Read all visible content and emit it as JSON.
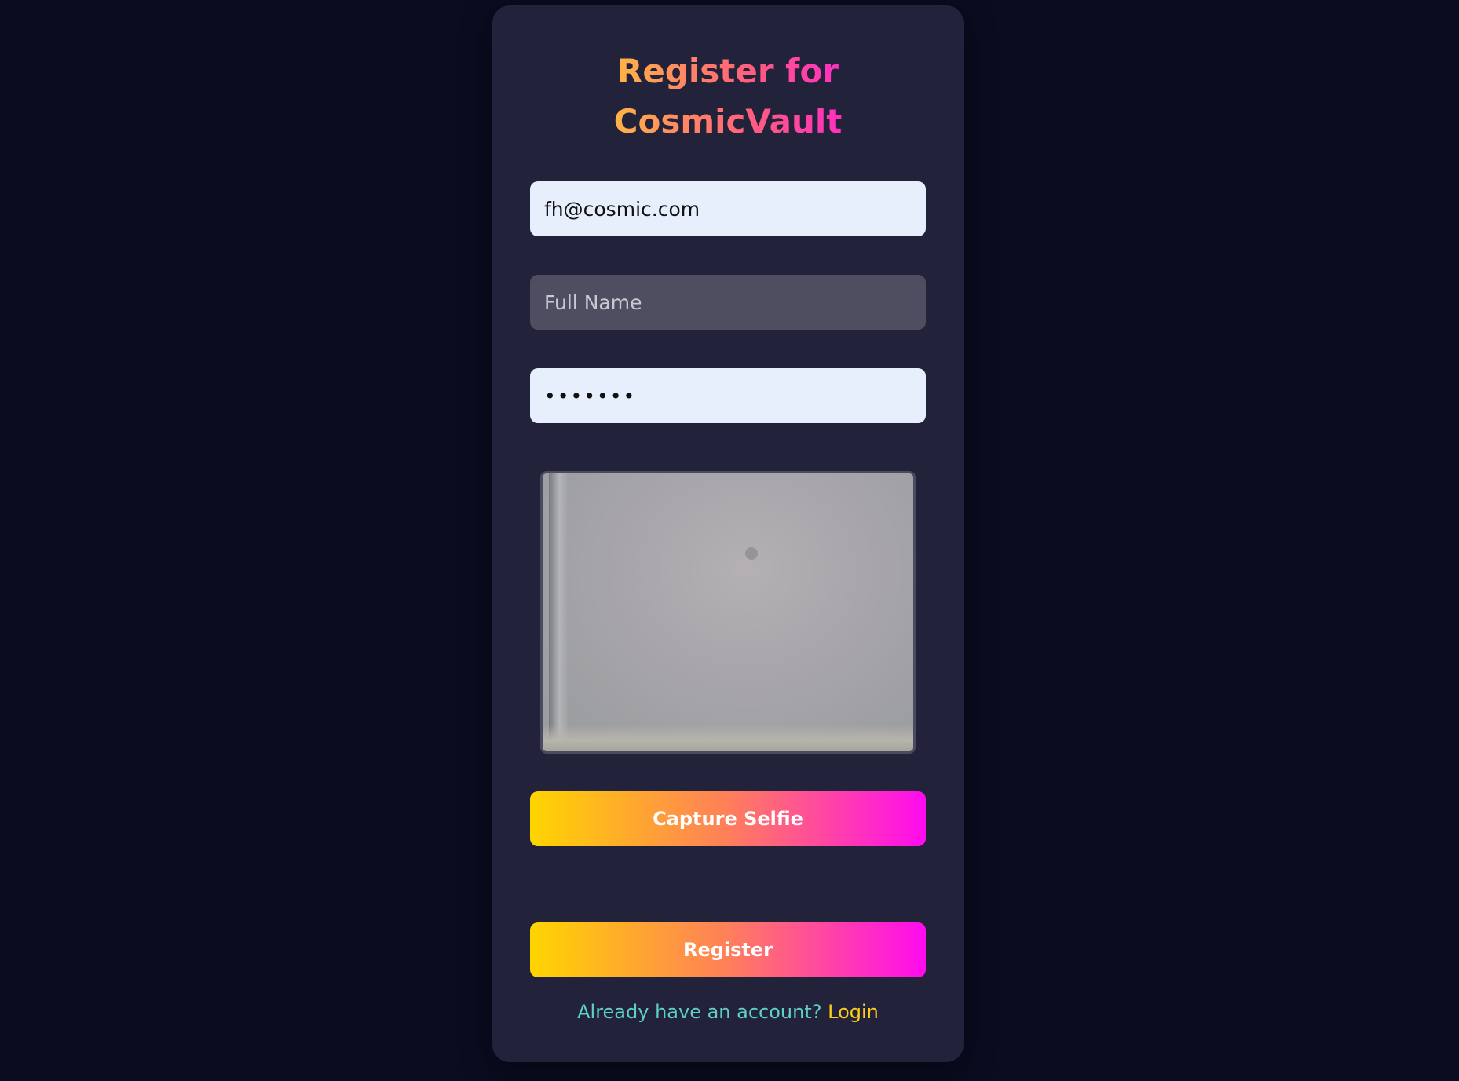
{
  "form": {
    "title_line1": "Register for",
    "title_line2": "CosmicVault",
    "email_value": "fh@cosmic.com",
    "name_placeholder": "Full Name",
    "name_value": "",
    "password_value": "•••••••",
    "capture_label": "Capture Selfie",
    "register_label": "Register",
    "footer_prompt": "Already have an account?",
    "login_link": "Login"
  },
  "colors": {
    "page_background": "#0a0c20",
    "card_background": "#22233a",
    "gradient_start": "#ffd500",
    "gradient_end": "#ff0bef",
    "prompt_text": "#5fd0c6",
    "link_text": "#ffcc1a"
  }
}
